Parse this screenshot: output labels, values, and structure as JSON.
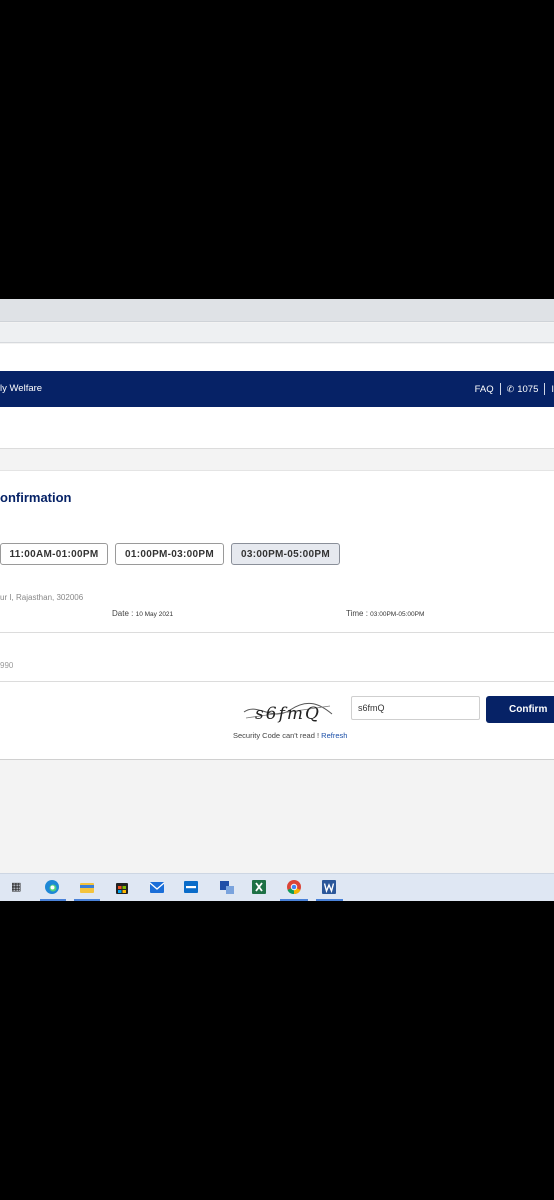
{
  "header": {
    "brand_fragment": "ly Welfare",
    "faq": "FAQ",
    "phone": "1075",
    "trailing_fragment": "I"
  },
  "confirmation": {
    "title": "onfirmation",
    "slots": [
      {
        "label": "11:00AM-01:00PM",
        "selected": false
      },
      {
        "label": "01:00PM-03:00PM",
        "selected": false
      },
      {
        "label": "03:00PM-05:00PM",
        "selected": true
      }
    ],
    "address": "ur I, Rajasthan, 302006",
    "date_label": "Date :",
    "date_value": "10 May 2021",
    "time_label": "Time :",
    "time_value": "03:00PM-05:00PM",
    "phone_fragment": "990"
  },
  "security": {
    "captcha_text": "s6fmQ",
    "input_value": "s6fmQ",
    "note": "Security Code can't read !",
    "refresh_label": "Refresh",
    "confirm_label": "Confirm"
  },
  "taskbar": {
    "icons": [
      "task-view-icon",
      "edge-icon",
      "file-explorer-icon",
      "store-icon",
      "mail-icon",
      "dell-icon",
      "app-icon",
      "excel-icon",
      "chrome-icon",
      "word-icon"
    ],
    "colors": {
      "accent": "#062266",
      "taskbar": "#dfe7f3"
    }
  }
}
